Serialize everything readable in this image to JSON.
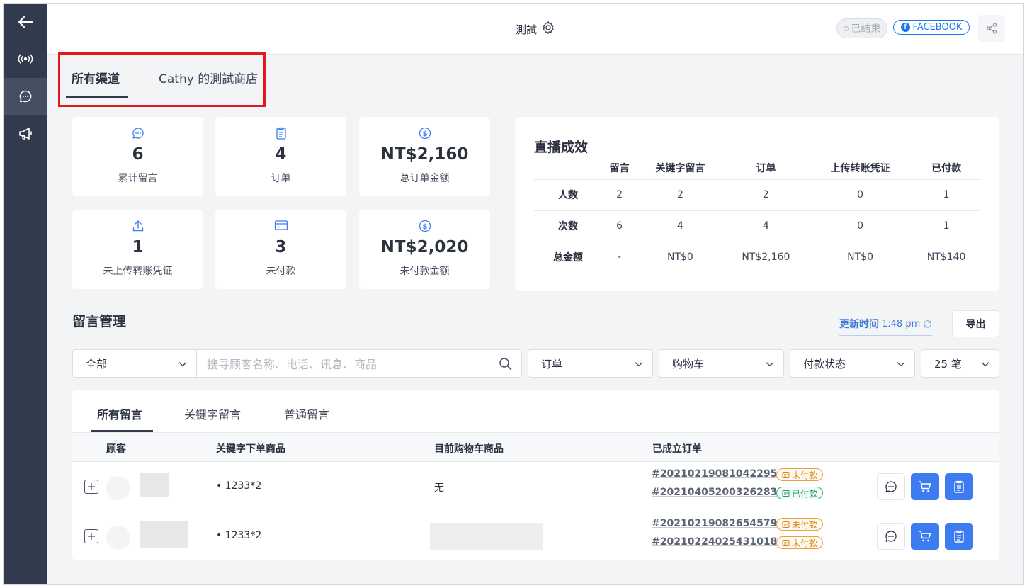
{
  "header": {
    "title": "測試",
    "status_badge": "已结束",
    "platform_badge": "FACEBOOK",
    "platform_letter": "f"
  },
  "channel_tabs": [
    "所有渠道",
    "Cathy 的測試商店"
  ],
  "stats": [
    {
      "icon": "chat-bubble-icon",
      "value": "6",
      "label": "累计留言"
    },
    {
      "icon": "clipboard-icon",
      "value": "4",
      "label": "订单"
    },
    {
      "icon": "dollar-coin-icon",
      "value": "NT$2,160",
      "label": "总订单金额"
    },
    {
      "icon": "upload-icon",
      "value": "1",
      "label": "未上传转账凭证"
    },
    {
      "icon": "credit-card-icon",
      "value": "3",
      "label": "未付款"
    },
    {
      "icon": "dollar-coin-icon",
      "value": "NT$2,020",
      "label": "未付款金额"
    }
  ],
  "performance": {
    "title": "直播成效",
    "columns": [
      "留言",
      "关键字留言",
      "订单",
      "上传转账凭证",
      "已付款"
    ],
    "rows": [
      {
        "label": "人数",
        "values": [
          "2",
          "2",
          "2",
          "0",
          "1"
        ]
      },
      {
        "label": "次数",
        "values": [
          "6",
          "4",
          "4",
          "0",
          "1"
        ]
      },
      {
        "label": "总金额",
        "values": [
          "-",
          "NT$0",
          "NT$2,160",
          "NT$0",
          "NT$140"
        ]
      }
    ]
  },
  "comments": {
    "title": "留言管理",
    "update_label": "更新时间",
    "update_time": "1:48 pm",
    "export_label": "导出",
    "filters": {
      "scope": "全部",
      "search_placeholder": "搜寻顾客名称、电话、讯息、商品",
      "order": "订单",
      "cart": "购物车",
      "payment": "付款状态",
      "page_size": "25 笔"
    },
    "tabs": [
      "所有留言",
      "关键字留言",
      "普通留言"
    ],
    "columns": [
      "顾客",
      "关键字下单商品",
      "目前购物车商品",
      "已成立订单"
    ],
    "rows": [
      {
        "keyword_item": "• 1233*2",
        "cart_item": "无",
        "orders": [
          {
            "id": "#20210219081042295",
            "status": "未付款",
            "state": "unpaid"
          },
          {
            "id": "#20210405200326283",
            "status": "已付款",
            "state": "paid"
          }
        ]
      },
      {
        "keyword_item": "• 1233*2",
        "cart_item": "",
        "orders": [
          {
            "id": "#20210219082654579",
            "status": "未付款",
            "state": "unpaid"
          },
          {
            "id": "#20210224025431018",
            "status": "未付款",
            "state": "unpaid"
          }
        ]
      }
    ]
  },
  "colors": {
    "sidebar": "#323a4d",
    "accent_blue": "#3c7bf0",
    "facebook": "#1877f2",
    "unpaid": "#d98a14",
    "paid": "#1b9e66",
    "highlight": "#e3171c"
  }
}
